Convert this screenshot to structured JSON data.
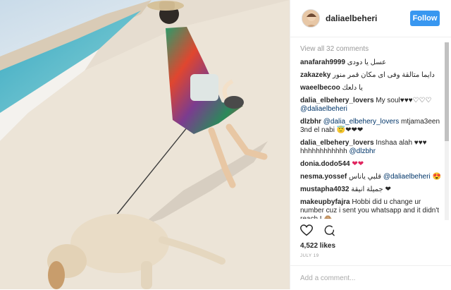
{
  "post": {
    "username": "daliaelbeheri",
    "follow_label": "Follow",
    "view_all": "View all 32 comments",
    "comments": [
      {
        "user": "anafarah9999",
        "text": "عسل يا دودى"
      },
      {
        "user": "zakazeky",
        "text": "دايما متالقة وفى اى مكان قمر منور"
      },
      {
        "user": "waeelbecoo",
        "text": "يا دلعك"
      },
      {
        "user": "dalia_elbehery_lovers",
        "text": "My soul♥♥♥♡♡♡",
        "mention": "@daliaelbeheri"
      },
      {
        "user": "dlzbhr",
        "mention": "@dalia_elbehery_lovers",
        "text": "mtjama3een 3nd el nabi 😇❤❤❤"
      },
      {
        "user": "dalia_elbehery_lovers",
        "text": "Inshaa alah ♥♥♥ hhhhhhhhhhhh",
        "mention": "@dlzbhr"
      },
      {
        "user": "donia.dodo544",
        "text": "❤❤"
      },
      {
        "user": "nesma.yossef",
        "text": "قلبي ياناس",
        "mention": "@daliaelbeheri",
        "emoji": "😍"
      },
      {
        "user": "mustapha4032",
        "text": "جميلة انيقة ❤"
      },
      {
        "user": "makeupbyfajra",
        "text": "Hobbi did u change ur number cuz i sent you whatsapp and it didn't reach I 🙈"
      }
    ],
    "likes": "4,522 likes",
    "date": "JULY 19",
    "comment_placeholder": "Add a comment...",
    "icons": {
      "like": "heart-icon",
      "comment": "comment-icon"
    }
  }
}
